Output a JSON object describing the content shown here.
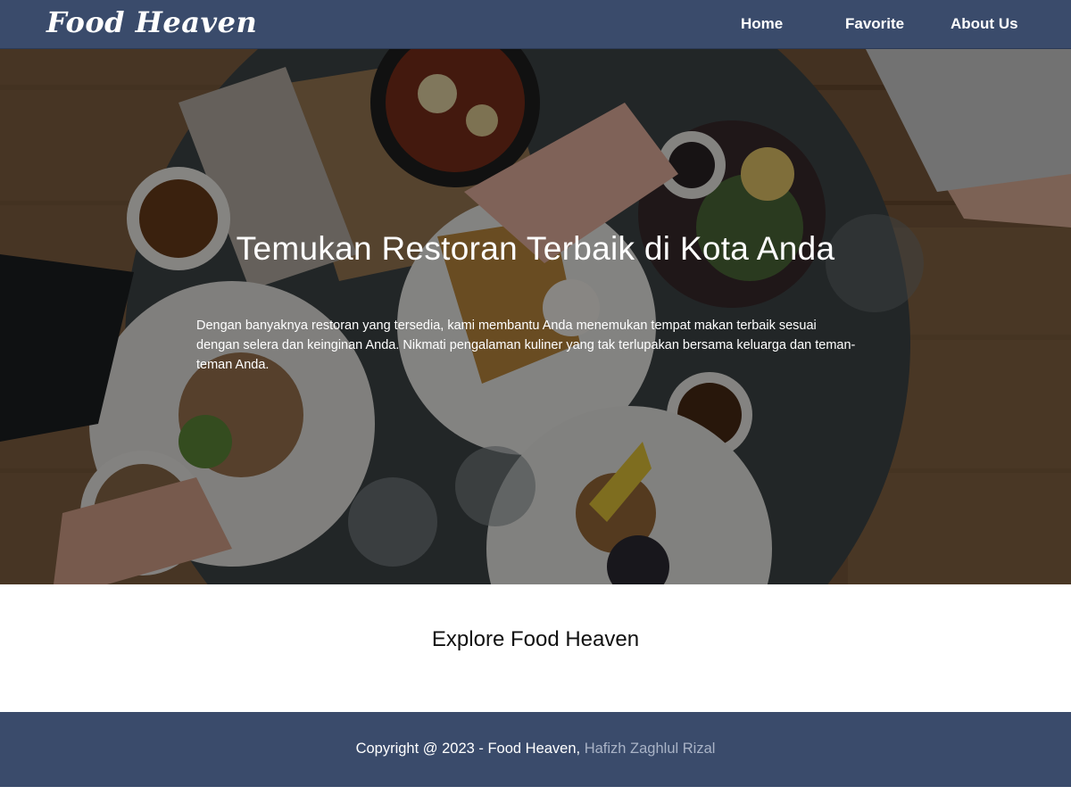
{
  "navbar": {
    "logo": "Food Heaven",
    "links": [
      {
        "label": "Home"
      },
      {
        "label": "Favorite"
      },
      {
        "label": "About Us"
      }
    ],
    "background": "#3a4b6b"
  },
  "hero": {
    "title": "Temukan Restoran Terbaik di Kota Anda",
    "description": "Dengan banyaknya restoran yang tersedia, kami membantu Anda menemukan tempat makan terbaik sesuai dengan selera dan keinginan Anda. Nikmati pengalaman kuliner yang tak terlupakan bersama keluarga dan teman-teman Anda."
  },
  "explore": {
    "title": "Explore Food Heaven"
  },
  "footer": {
    "copyright": "Copyright @ 2023 - Food Heaven, ",
    "author": "Hafizh Zaghlul Rizal",
    "author_color": "#a9b3c6"
  }
}
